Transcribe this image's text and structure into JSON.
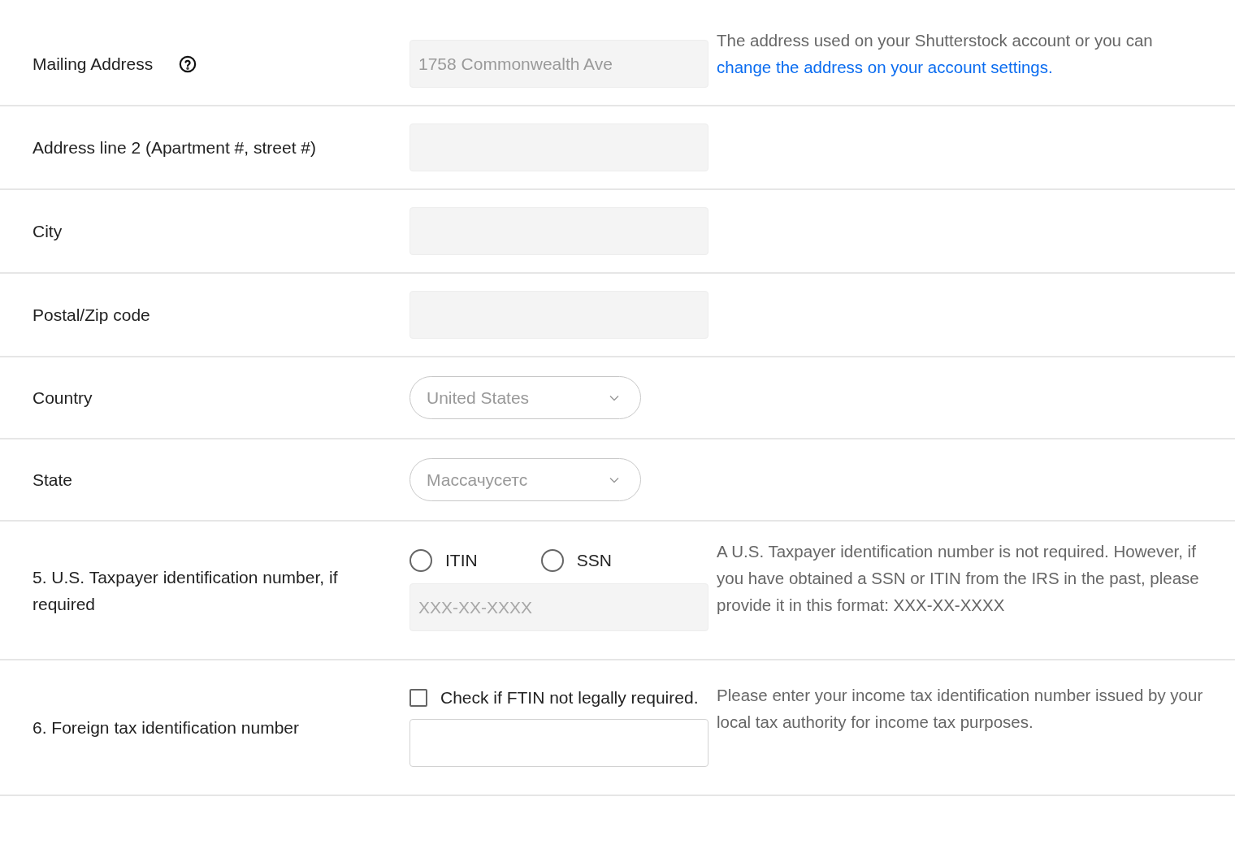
{
  "rows": [
    {
      "kind": "text",
      "label": "Mailing Address",
      "help_icon": true,
      "field": {
        "value": "1758 Commonwealth Ave",
        "disabled": true
      },
      "help": {
        "text": "The address used on your Shutterstock account or you can",
        "link": "change the address on your account settings."
      }
    },
    {
      "kind": "text",
      "label": "Address line 2 (Apartment #, street #)",
      "field": {
        "disabled": true
      }
    },
    {
      "kind": "text",
      "label": "City",
      "field": {
        "disabled": true
      }
    },
    {
      "kind": "text",
      "label": "Postal/Zip code",
      "field": {
        "disabled": true
      }
    },
    {
      "kind": "select",
      "label": "Country",
      "select": {
        "value": "United States"
      }
    },
    {
      "kind": "select",
      "label": "State",
      "select": {
        "value": "Массачусетс"
      }
    },
    {
      "kind": "radios",
      "label": "5. U.S. Taxpayer identification number, if required",
      "options": [
        {
          "label": "ITIN",
          "selected": false
        },
        {
          "label": "SSN",
          "selected": false
        }
      ],
      "field": {
        "placeholder": "XXX-XX-XXXX",
        "disabled": true
      },
      "help": {
        "text": "A U.S. Taxpayer identification number is not required. However, if you have obtained a SSN or ITIN from the IRS in the past, please provide it in this format: XXX-XX-XXXX"
      }
    },
    {
      "kind": "checkbox",
      "label": "6. Foreign tax identification number",
      "checkbox": {
        "label": "Check if FTIN not legally required.",
        "checked": false
      },
      "field": {
        "disabled": false
      },
      "help": {
        "text": "Please enter your income tax identification number issued by your local tax authority for income tax purposes."
      }
    }
  ]
}
